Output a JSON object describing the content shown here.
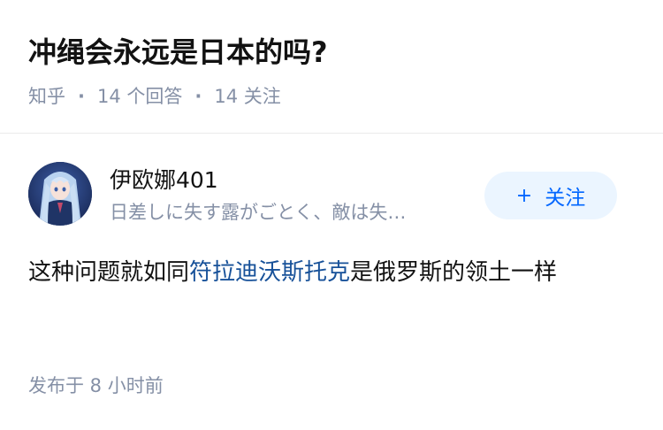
{
  "question": {
    "title": "冲绳会永远是日本的吗?",
    "source": "知乎",
    "separator": "·",
    "answers_count": "14 个回答",
    "followers_count": "14 关注"
  },
  "answer": {
    "author": {
      "name": "伊欧娜401",
      "bio": "日差しに失す露がごとく、敵は失…",
      "avatar_icon": "anime-character-avatar"
    },
    "follow_button": {
      "plus": "+",
      "label": "关注"
    },
    "content": {
      "text_before": "这种问题就如同",
      "link_text": "符拉迪沃斯托克",
      "text_after": "是俄罗斯的领土一样"
    },
    "published_time": "发布于 8 小时前"
  },
  "colors": {
    "meta_gray": "#8590a6",
    "link_blue": "#175199",
    "button_bg": "#ebf5ff",
    "button_text": "#0066ff"
  }
}
